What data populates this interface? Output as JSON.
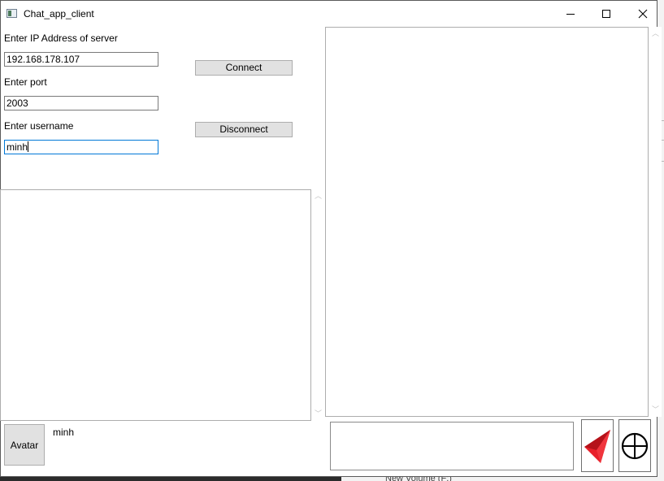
{
  "window": {
    "title": "Chat_app_client",
    "controls": {
      "minimize": "—",
      "maximize": "☐",
      "close": "✕"
    }
  },
  "form": {
    "ip_label": "Enter IP Address of server",
    "ip_value": "192.168.178.107",
    "port_label": "Enter port",
    "port_value": "2003",
    "username_label": "Enter username",
    "username_value": "minh",
    "connect_label": "Connect",
    "disconnect_label": "Disconnect"
  },
  "profile": {
    "avatar_label": "Avatar",
    "username": "minh"
  },
  "message": {
    "input_value": "",
    "send_icon": "paper-plane-icon",
    "add_icon": "plus-circle-icon"
  },
  "background": {
    "partial_text": "New Volume (F:)"
  },
  "colors": {
    "accent": "#0078d7",
    "send_icon": "#e8202a",
    "button_face": "#e1e1e1"
  }
}
